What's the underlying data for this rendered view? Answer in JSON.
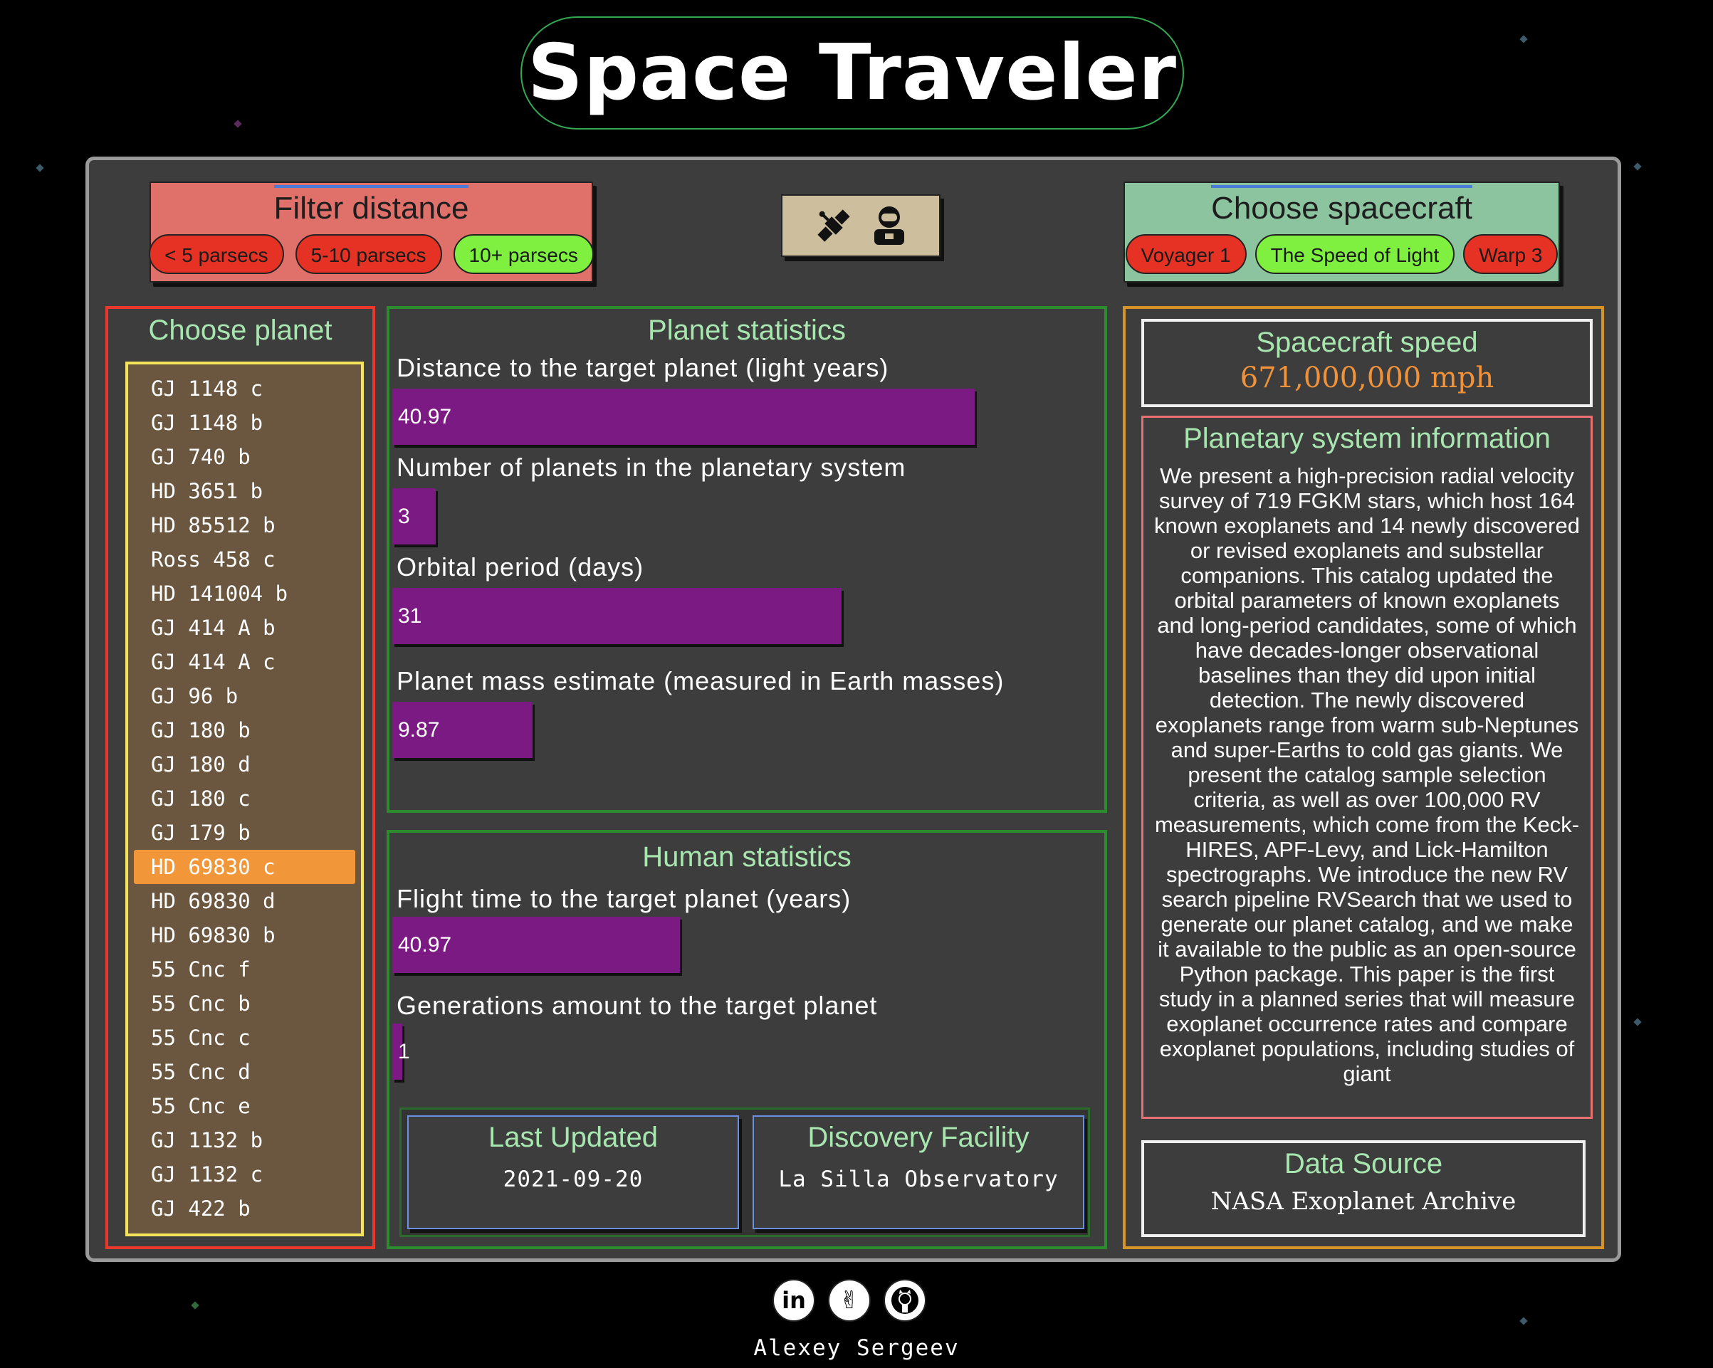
{
  "app": {
    "title": "Space Traveler"
  },
  "filter": {
    "title": "Filter distance",
    "options": [
      {
        "label": "< 5 parsecs",
        "state": "inactive"
      },
      {
        "label": "5-10 parsecs",
        "state": "inactive"
      },
      {
        "label": "10+ parsecs",
        "state": "active"
      }
    ]
  },
  "spacecraft": {
    "title": "Choose spacecraft",
    "options": [
      {
        "label": "Voyager 1",
        "state": "inactive"
      },
      {
        "label": "The Speed of Light",
        "state": "active"
      },
      {
        "label": "Warp 3",
        "state": "inactive"
      }
    ]
  },
  "mode_toggle": {
    "icons": [
      "satellite-icon",
      "astronaut-icon"
    ]
  },
  "planets": {
    "title": "Choose planet",
    "selected": "HD 69830 c",
    "items": [
      "GJ 1148 c",
      "GJ 1148 b",
      "GJ 740 b",
      "HD 3651 b",
      "HD 85512 b",
      "Ross 458 c",
      "HD 141004 b",
      "GJ 414 A b",
      "GJ 414 A c",
      "GJ 96 b",
      "GJ 180 b",
      "GJ 180 d",
      "GJ 180 c",
      "GJ 179 b",
      "HD 69830 c",
      "HD 69830 d",
      "HD 69830 b",
      "55 Cnc f",
      "55 Cnc b",
      "55 Cnc c",
      "55 Cnc d",
      "55 Cnc e",
      "GJ 1132 b",
      "GJ 1132 c",
      "GJ 422 b"
    ]
  },
  "planet_stats": {
    "title": "Planet statistics",
    "items": [
      {
        "label": "Distance to the target planet (light years)",
        "value": "40.97",
        "fraction": 0.81
      },
      {
        "label": "Number of planets in the planetary system",
        "value": "3",
        "fraction": 0.06
      },
      {
        "label": "Orbital period (days)",
        "value": "31",
        "fraction": 0.625
      },
      {
        "label": "Planet mass estimate (measured in Earth masses)",
        "value": "9.87",
        "fraction": 0.195
      }
    ]
  },
  "human_stats": {
    "title": "Human statistics",
    "items": [
      {
        "label": "Flight time to the target planet (years)",
        "value": "40.97",
        "fraction": 0.4
      },
      {
        "label": "Generations amount to the target planet",
        "value": "1",
        "fraction": 0.014
      }
    ]
  },
  "last_updated": {
    "title": "Last Updated",
    "value": "2021-09-20"
  },
  "discovery": {
    "title": "Discovery Facility",
    "value": "La Silla Observatory"
  },
  "speed": {
    "title": "Spacecraft speed",
    "value": "671,000,000 mph"
  },
  "system_info": {
    "title": "Planetary system information",
    "text": "We present a high-precision radial velocity survey of 719 FGKM stars, which host 164 known exoplanets and 14 newly discovered or revised exoplanets and substellar companions. This catalog updated the orbital parameters of known exoplanets and long-period candidates, some of which have decades-longer observational baselines than they did upon initial detection. The newly discovered exoplanets range from warm sub-Neptunes and super-Earths to cold gas giants. We present the catalog sample selection criteria, as well as over 100,000 RV measurements, which come from the Keck-HIRES, APF-Levy, and Lick-Hamilton spectrographs. We introduce the new RV search pipeline RVSearch that we used to generate our planet catalog, and we make it available to the public as an open-source Python package. This paper is the first study in a planned series that will measure exoplanet occurrence rates and compare exoplanet populations, including studies of giant"
  },
  "data_source": {
    "title": "Data Source",
    "value": "NASA Exoplanet Archive"
  },
  "footer": {
    "author": "Alexey Sergeev",
    "links": [
      "linkedin-icon",
      "peace-hand-icon",
      "github-icon"
    ]
  },
  "colors": {
    "active": "#7ff03f",
    "inactive": "#e53224",
    "selected_planet": "#f2963a",
    "bar": "#7c1a84",
    "panel_title": "#a8e6b0",
    "speed_value": "#f0923a"
  }
}
